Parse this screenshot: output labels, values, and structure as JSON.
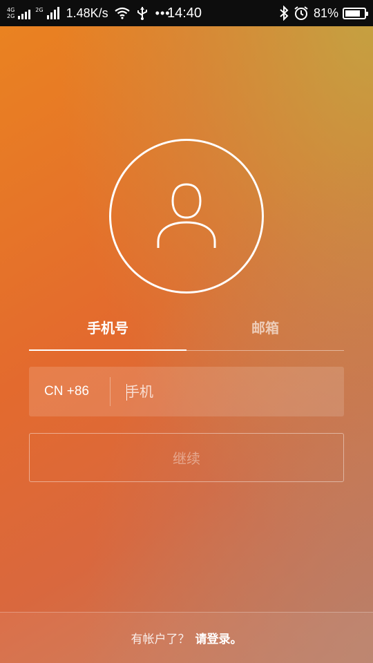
{
  "status_bar": {
    "network_top": "4G",
    "network_bottom": "2G",
    "network2_label": "2G",
    "speed": "1.48K/s",
    "more": "•••",
    "time": "14:40",
    "battery_percent_text": "81%",
    "battery_level": 0.81,
    "icons": [
      "signal-icon",
      "wifi-icon",
      "usb-icon",
      "bluetooth-icon",
      "alarm-icon",
      "battery-icon"
    ]
  },
  "avatar": {
    "icon": "user-icon"
  },
  "tabs": [
    {
      "label": "手机号",
      "active": true
    },
    {
      "label": "邮箱",
      "active": false
    }
  ],
  "phone_form": {
    "country_code": "CN +86",
    "placeholder": "手机",
    "value": ""
  },
  "continue_button": {
    "label": "继续",
    "enabled": false
  },
  "footer": {
    "question": "有帐户了？",
    "login_link": "请登录。"
  },
  "colors": {
    "gradient_top_left": "#ea8420",
    "gradient_bottom": "#d9683e",
    "gradient_top_right": "#bea846",
    "status_bar": "#0d0d0d"
  }
}
